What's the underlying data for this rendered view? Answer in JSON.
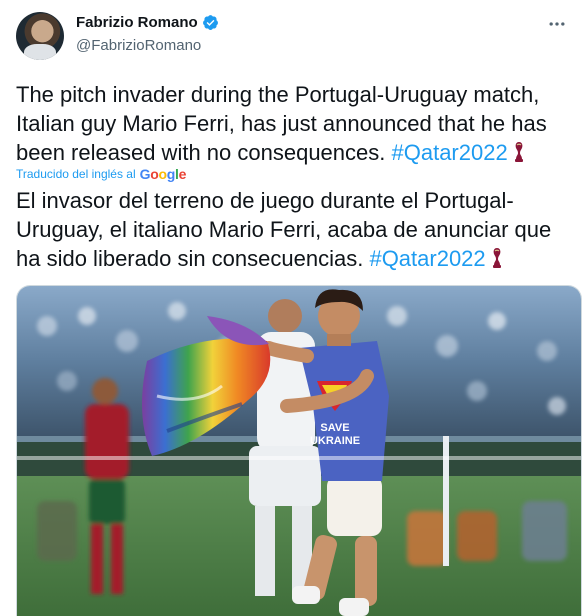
{
  "author": {
    "name": "Fabrizio Romano",
    "handle": "@FabrizioRomano"
  },
  "tweet": {
    "text_original": "The pitch invader during the Portugal-Uruguay match, Italian guy Mario Ferri, has just announced that he has been released with no consequences.",
    "hashtag": "#Qatar2022",
    "translated_label": "Traducido del inglés al",
    "translator": [
      "G",
      "o",
      "o",
      "g",
      "l",
      "e"
    ],
    "text_translated": "El invasor del terreno de juego durante el Portugal-Uruguay, el italiano Mario Ferri, acaba de anunciar que ha sido liberado sin consecuencias."
  },
  "media": {
    "shirt_text": "SAVE UKRAINE"
  },
  "colors": {
    "link": "#1d9bf0",
    "verified": "#1d9bf0",
    "muted": "#536471"
  }
}
